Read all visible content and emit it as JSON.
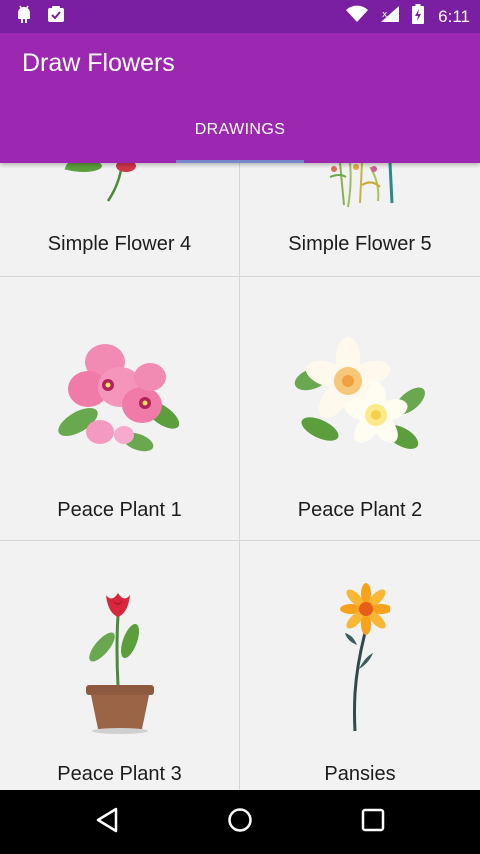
{
  "status_bar": {
    "time": "6:11",
    "icons_left": [
      "android-icon",
      "clipboard-icon"
    ],
    "icons_right": [
      "wifi-icon",
      "signal-icon",
      "battery-icon"
    ]
  },
  "app_bar": {
    "title": "Draw Flowers",
    "tabs": [
      {
        "label": "DRAWINGS",
        "selected": true
      }
    ],
    "background_color": "#9c27b0",
    "status_color": "#7b1fa2",
    "indicator_color": "#7986cb"
  },
  "drawings": [
    {
      "label": "Simple Flower 4",
      "icon": "simple-flower-icon"
    },
    {
      "label": "Simple Flower 5",
      "icon": "wildflowers-icon"
    },
    {
      "label": "Peace Plant 1",
      "icon": "orchid-icon"
    },
    {
      "label": "Peace Plant 2",
      "icon": "plumeria-icon"
    },
    {
      "label": "Peace Plant 3",
      "icon": "potted-tulip-icon"
    },
    {
      "label": "Pansies",
      "icon": "sunflower-icon"
    }
  ],
  "nav_bar": {
    "buttons": [
      "back-icon",
      "home-icon",
      "recents-icon"
    ]
  }
}
